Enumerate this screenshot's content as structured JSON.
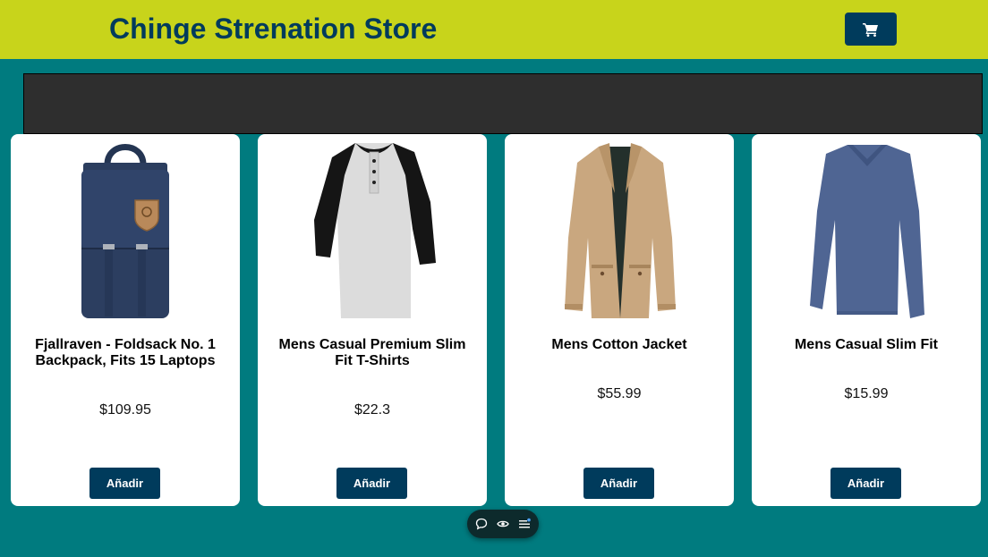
{
  "header": {
    "title": "Chinge Strenation Store",
    "cart_icon": "shopping-cart-icon"
  },
  "colors": {
    "header_bg": "#c8d41b",
    "page_bg": "#007b7f",
    "primary": "#003b5c",
    "banner_bg": "#2e2e2e"
  },
  "products": [
    {
      "title": "Fjallraven - Foldsack No. 1 Backpack, Fits 15 Laptops",
      "price": "$109.95",
      "button": "Añadir",
      "image": "navy backpack"
    },
    {
      "title": "Mens Casual Premium Slim Fit T-Shirts",
      "price": "$22.3",
      "button": "Añadir",
      "image": "grey and black raglan henley shirt"
    },
    {
      "title": "Mens Cotton Jacket",
      "price": "$55.99",
      "button": "Añadir",
      "image": "khaki cotton jacket"
    },
    {
      "title": "Mens Casual Slim Fit",
      "price": "$15.99",
      "button": "Añadir",
      "image": "blue long sleeve v-neck shirt"
    }
  ],
  "toolbar": {
    "icons": [
      "comment-icon",
      "eye-icon",
      "menu-settings-icon"
    ]
  }
}
